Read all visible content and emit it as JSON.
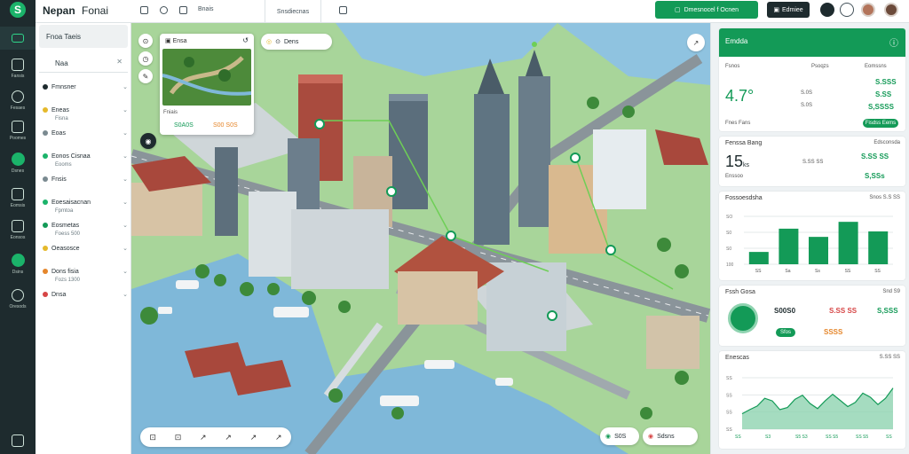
{
  "app": {
    "title": "Nepan",
    "subtitle": "Fonai"
  },
  "topbar": {
    "items": [
      "Bnais",
      "Snsdiecnas"
    ],
    "primary_button": "Dmesnocel f Ocnen",
    "secondary_button": "Edmiee"
  },
  "rail": {
    "items": [
      "Fansis",
      "Fesaes",
      "Poomes",
      "Dsnes",
      "Eomsis",
      "Eonsos",
      "Dsins",
      "Oresods"
    ]
  },
  "panel": {
    "search": "Fnoa Taeis",
    "filter": "Naa",
    "layers": [
      {
        "label": "Fmnsner",
        "color": "#1e2b2e",
        "sub": ""
      },
      {
        "label": "Eneas",
        "color": "#e5b92b",
        "sub": "Fisna"
      },
      {
        "label": "Eoas",
        "color": "#7a8a90",
        "sub": ""
      },
      {
        "label": "Eonos Cisnaa",
        "color": "#1bb36a",
        "sub": "Eooms"
      },
      {
        "label": "Fnsis",
        "color": "#7a8a90",
        "sub": ""
      },
      {
        "label": "Eoesaisacnan",
        "color": "#1bb36a",
        "sub": "Fpmtoa"
      },
      {
        "label": "Eosmetas",
        "color": "#139a57",
        "sub": "Foess 500"
      },
      {
        "label": "Oeasosce",
        "color": "#e5b92b",
        "sub": ""
      },
      {
        "label": "Dons fisia",
        "color": "#e5862b",
        "sub": "Fozs 1300"
      },
      {
        "label": "Dnsa",
        "color": "#d64545",
        "sub": ""
      }
    ]
  },
  "map": {
    "popup_title": "Ensa",
    "popup_caption": "Fniais",
    "popup_value_green": "S0A0S",
    "popup_value_orange": "S00 S0S",
    "top_chip": "Dens",
    "bottom_tools": [
      "⊡",
      "⊡",
      "↗",
      "↗",
      "↗",
      "↗"
    ],
    "bottom_chip_a": "S0S",
    "bottom_chip_b": "Sdsns"
  },
  "stats": {
    "header": "Emdda",
    "summary": {
      "col1": "Fsnos",
      "col2": "Psoqzs",
      "col3": "Eomssns",
      "big": "4.7°",
      "r1a": "S.0S",
      "r1b": "S.SSS",
      "r2a": "S.0S",
      "r2b": "S.SS",
      "r3": "S,SSSS",
      "footer": "Fnes Fans",
      "button": "Fisdss Eems"
    },
    "card2": {
      "title": "Fenssa Bang",
      "right": "Edsconsda",
      "big": "15",
      "unit": "ks",
      "v1": "S.SS SS",
      "v2": "S.SS SS",
      "caption": "Enssoo",
      "v3": "S,SSs"
    },
    "bar_card": {
      "title": "Fossoesdsha",
      "right": "Snos S.S SS"
    },
    "card4": {
      "title": "Fssh Gosa",
      "right": "Snd S9",
      "v1": "S00S0",
      "v2": "S.SS SS",
      "v3": "Sfos",
      "v4": "SSSS",
      "v5": "S,SSS"
    },
    "area_card": {
      "title": "Enescas",
      "right": "S.SS SS"
    }
  },
  "chart_data": [
    {
      "type": "bar",
      "title": "Fossoesdsha",
      "categories": [
        "SS",
        "Sa",
        "Ss",
        "SS",
        "SS"
      ],
      "values": [
        18,
        52,
        40,
        62,
        48
      ],
      "ylim": [
        0,
        70
      ],
      "yticks": [
        "100",
        "S0",
        "S0",
        "SO"
      ],
      "colors": {
        "bar": "#139a57"
      }
    },
    {
      "type": "area",
      "title": "Enescas",
      "x": [
        0,
        1,
        2,
        3,
        4,
        5,
        6,
        7,
        8,
        9,
        10,
        11,
        12,
        13,
        14,
        15,
        16,
        17,
        18,
        19,
        20
      ],
      "values": [
        30,
        38,
        45,
        60,
        55,
        38,
        42,
        58,
        66,
        50,
        40,
        55,
        68,
        56,
        44,
        52,
        70,
        62,
        48,
        60,
        80
      ],
      "ylim": [
        0,
        100
      ],
      "xticks": [
        "SS",
        "S3",
        "S5 S3",
        "SS S5",
        "SS S5",
        "SS"
      ],
      "yticks": [
        "SS",
        "SS",
        "SS",
        "SS"
      ],
      "colors": {
        "fill": "#8fd3b0",
        "line": "#139a57"
      }
    }
  ]
}
